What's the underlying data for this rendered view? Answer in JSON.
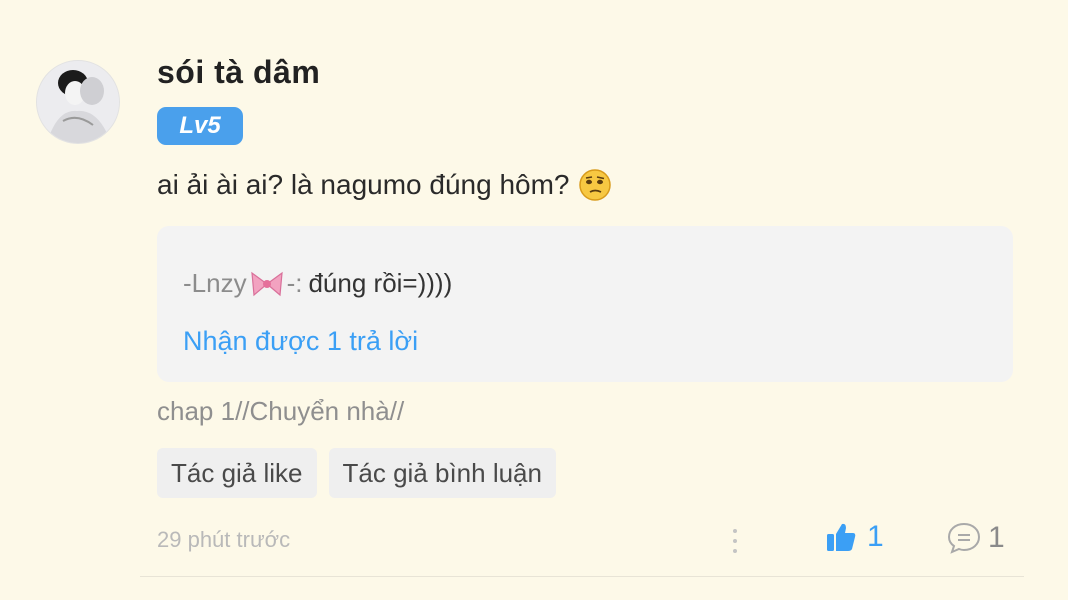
{
  "comment": {
    "author": "sói tà dâm",
    "level": "Lv5",
    "text": "ai ải ài ai?  là nagumo đúng hôm?",
    "emoji_icon": "thinking-face-icon"
  },
  "reply_preview": {
    "author": "-Lnzy",
    "author_suffix": "-:",
    "text": "đúng rồi=))))",
    "decoration_icon": "bow-icon",
    "reply_count_text": "Nhận được 1 trả lời"
  },
  "chapter": "chap 1//Chuyển nhà//",
  "tags": [
    "Tác giả like",
    "Tác giả bình luận"
  ],
  "timestamp": "29 phút trước",
  "actions": {
    "likes": "1",
    "replies": "1",
    "like_icon": "thumbs-up-icon",
    "reply_icon": "comment-bubble-icon",
    "more_icon": "more-vertical-icon"
  },
  "colors": {
    "background": "#fdf9e8",
    "accent": "#3b9ff5",
    "level_badge": "#4aa0ec"
  }
}
